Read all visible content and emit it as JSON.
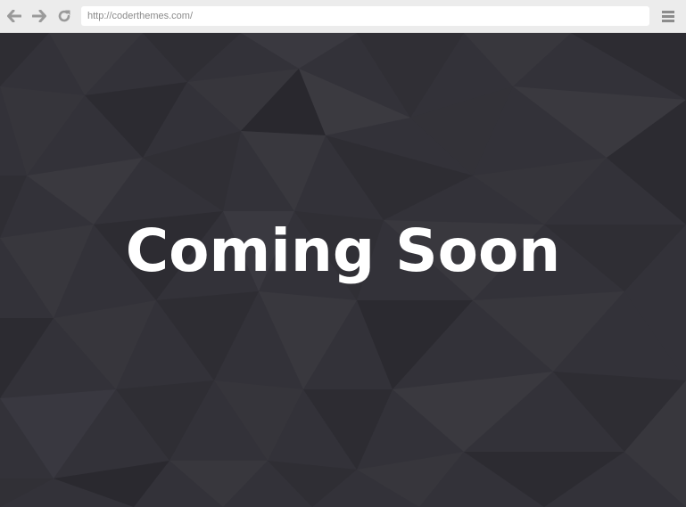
{
  "browser": {
    "url": "http://coderthemes.com/",
    "icons": {
      "back": "arrow-left-icon",
      "forward": "arrow-right-icon",
      "reload": "reload-icon",
      "menu": "hamburger-menu-icon"
    }
  },
  "page": {
    "headline": "Coming Soon",
    "background_color": "#333239",
    "text_color": "#ffffff"
  }
}
